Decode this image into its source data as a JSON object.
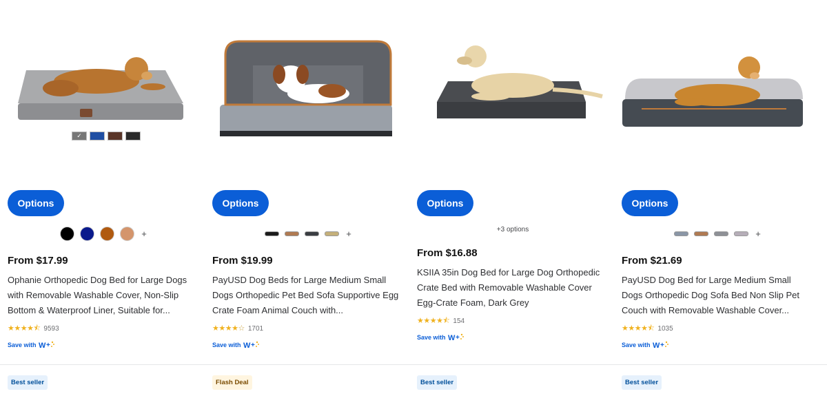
{
  "colors": {
    "accent": "#0b5ed7",
    "star": "#f0b21f",
    "best_seller_bg": "#e6f1fc",
    "flash_deal_bg": "#fff5e0"
  },
  "products": [
    {
      "image_alt": "Golden retriever lying on a grey orthopedic dog bed",
      "image_swatches": [
        "#777777",
        "#1f4ea3",
        "#5a3528",
        "#2a2a2a"
      ],
      "options_label": "Options",
      "variant_colors": [
        "#000000",
        "#0a1a8c",
        "#b05a10",
        "#d4956c"
      ],
      "variant_more": "+",
      "price": "From $17.99",
      "title": "Ophanie Orthopedic Dog Bed for Large Dogs with Removable Washable Cover, Non-Slip Bottom & Waterproof Liner, Suitable for...",
      "rating": 4.5,
      "review_count": "9593",
      "save_label": "Save with",
      "badge": "Best seller"
    },
    {
      "image_alt": "Shih tzu puppy sitting in a grey sofa dog bed",
      "options_label": "Options",
      "variant_pills": [
        "#1b1b1b",
        "#b07a52",
        "#3a3d42",
        "#c4b07a"
      ],
      "variant_more": "+",
      "price": "From $19.99",
      "title": "PayUSD Dog Beds for Large Medium Small Dogs Orthopedic Pet Bed Sofa Supportive Egg Crate Foam Animal Couch with...",
      "rating": 4,
      "review_count": "1701",
      "save_label": "Save with",
      "badge": "Flash Deal"
    },
    {
      "image_alt": "Labrador lying on a dark grey crate bed",
      "options_label": "Options",
      "options_count": "+3 options",
      "price": "From $16.88",
      "title": "KSIIA 35in Dog Bed for Large Dog Orthopedic Crate Bed with Removable Washable Cover Egg-Crate Foam, Dark Grey",
      "rating": 4.5,
      "review_count": "154",
      "save_label": "Save with",
      "badge": "Best seller"
    },
    {
      "image_alt": "Golden retriever on a dark grey bolster sofa bed",
      "options_label": "Options",
      "variant_pills": [
        "#8a96a6",
        "#b07a52",
        "#8e9096",
        "#b6aeb8"
      ],
      "variant_more": "+",
      "price": "From $21.69",
      "title": "PayUSD Dog Bed for Large Medium Small Dogs Orthopedic Dog Sofa Bed Non Slip Pet Couch with Removable Washable Cover...",
      "rating": 4.5,
      "review_count": "1035",
      "save_label": "Save with",
      "badge": "Best seller"
    }
  ]
}
